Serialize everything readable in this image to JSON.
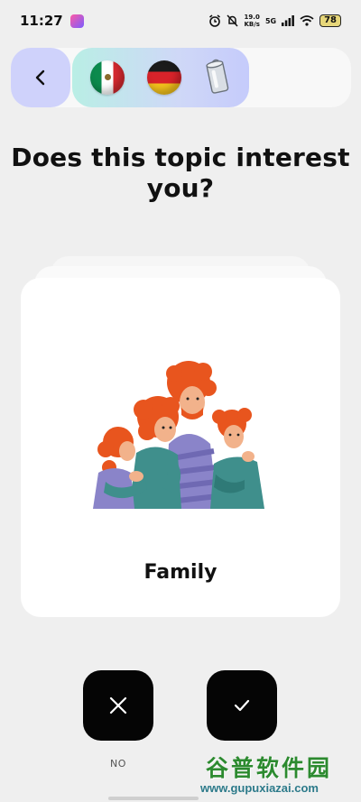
{
  "status_bar": {
    "time": "11:27",
    "speed_top": "19.0",
    "speed_unit": "KB/s",
    "network": "5G",
    "battery": "78"
  },
  "languages": {
    "items": [
      {
        "icon": "mexico-flag-icon"
      },
      {
        "icon": "germany-flag-icon"
      },
      {
        "icon": "tin-can-icon"
      }
    ]
  },
  "question": {
    "title": "Does this topic interest you?"
  },
  "topic_card": {
    "label": "Family",
    "image": "family-illustration"
  },
  "actions": {
    "no_label": "NO"
  },
  "watermark": {
    "title": "谷普软件园",
    "url": "www.gupuxiazai.com"
  },
  "colors": {
    "background": "#efefef",
    "back_button": "#cfd2fb",
    "button_dark": "#050505",
    "hair": "#e8551e",
    "shirt_teal": "#3f8f8c",
    "shirt_purple": "#8a84c9"
  }
}
